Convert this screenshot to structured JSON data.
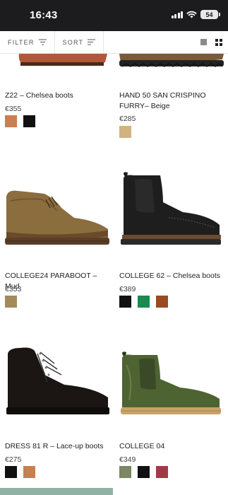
{
  "status": {
    "time": "16:43",
    "battery": "54"
  },
  "toolbar": {
    "filter_label": "FILTER",
    "sort_label": "SORT"
  },
  "products": [
    {
      "name": "Z22 – Chelsea boots",
      "price": "€355",
      "swatches": [
        "#c8804e",
        "#111111"
      ]
    },
    {
      "name": "HAND 50 SAN CRISPINO FURRY– Beige",
      "price": "€285",
      "swatches": [
        "#d2b27e"
      ]
    },
    {
      "name": "COLLEGE24 PARABOOT – Mud",
      "price": "€353",
      "swatches": [
        "#a38a5b"
      ]
    },
    {
      "name": "COLLEGE 62 – Chelsea boots",
      "price": "€389",
      "swatches": [
        "#111111",
        "#1a8a52",
        "#9a4a22"
      ]
    },
    {
      "name": "DRESS 81 R – Lace-up boots",
      "price": "€275",
      "swatches": [
        "#111111",
        "#c8804e"
      ]
    },
    {
      "name": "COLLEGE 04",
      "price": "€349",
      "swatches": [
        "#7a8664",
        "#111111",
        "#a13a46"
      ]
    }
  ],
  "icons": [
    "wifi-icon",
    "signal-icon",
    "battery-icon",
    "filter-icon",
    "sort-icon",
    "single-view-icon",
    "grid-view-icon"
  ]
}
